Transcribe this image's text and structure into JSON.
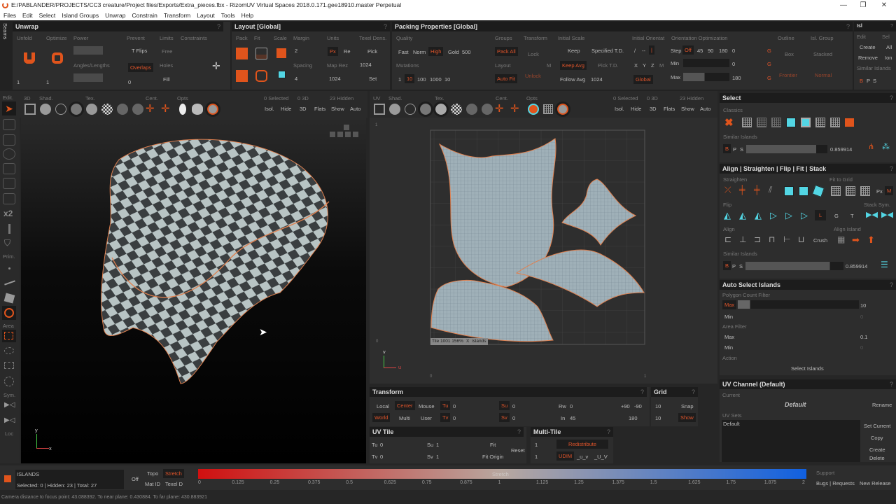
{
  "window": {
    "title": "E:/PABLANDER/PROJECTS/CC3 creature/Project files/Exports/Extra_pieces.fbx - RizomUV  Virtual Spaces 2018.0.171.gee18910.master Perpetual",
    "min": "—",
    "max": "❐",
    "close": "✕"
  },
  "menu": [
    "Files",
    "Edit",
    "Select",
    "Island Groups",
    "Unwrap",
    "Constrain",
    "Transform",
    "Layout",
    "Tools",
    "Help"
  ],
  "seams": "Seams",
  "unwrap": {
    "title": "Unwrap",
    "help": "?",
    "unfold": "Unfold",
    "optimize": "Optimize",
    "power": "Power",
    "angles": "Angles/Lengths",
    "prevent": "Prevent",
    "tflips": "T Flips",
    "overlaps": "Overlaps",
    "limits": "Limits",
    "free": "Free",
    "holes": "Holes",
    "fill": "Fill",
    "constraints": "Constraints",
    "unfold_val": "1",
    "optimize_val": "1",
    "prevent_val": "0"
  },
  "layout": {
    "title": "Layout [Global]",
    "help": "?",
    "pack": "Pack",
    "fit": "Fit",
    "scale": "Scale",
    "margin": "Margin",
    "margin_val": "2",
    "spacing": "Spacing",
    "spacing_val": "4",
    "units": "Units",
    "px": "Px",
    "re": "Re",
    "maprez": "Map Rez",
    "maprez_val": "1024",
    "texel": "Texel Dens.",
    "pick": "Pick",
    "texel_val": "1024",
    "set": "Set"
  },
  "packing": {
    "title": "Packing Properties [Global]",
    "help": "?",
    "quality": "Quality",
    "fast": "Fast",
    "norm": "Norm",
    "high": "High",
    "gold": "Gold",
    "gold_val": "500",
    "mutations": "Mutations",
    "m1": "1",
    "m10": "10",
    "m100": "100",
    "m1000": "1000",
    "mut_val": "10",
    "groups": "Groups",
    "packall": "Pack All",
    "layout": "Layout",
    "autofit": "Auto Fit",
    "transform": "Transform",
    "lock": "Lock",
    "unlock": "Unlock",
    "m": "M",
    "initscale": "Initial Scale",
    "keep": "Keep",
    "spectd": "Specified T.D.",
    "keepavg": "Keep Avg",
    "picktd": "Pick T.D.",
    "followavg": "Follow Avg",
    "follow_val": "1024",
    "initorient": "Initial Orientat",
    "o1": "/",
    "o2": "--",
    "o3": "|",
    "x": "X",
    "y": "Y",
    "z": "Z",
    "global": "Global",
    "orientopt": "Orientation Optimization",
    "step": "Step",
    "off": "Off",
    "s45": "45",
    "s90": "90",
    "s180": "180",
    "step_val": "0",
    "min": "Min",
    "min_val": "0",
    "max": "Max",
    "max_val": "180",
    "g": "G",
    "outline": "Outline",
    "box": "Box",
    "frontier": "Frontier",
    "islgroup": "Isl. Group",
    "stacked": "Stacked",
    "normal": "Normal"
  },
  "islands_panel": {
    "title": "Isl",
    "help": "?",
    "edit": "Edit",
    "sel": "Sel",
    "create": "Create",
    "all": "All",
    "remove": "Remove",
    "join": "Ion",
    "similar": "Similar Islands",
    "b": "B",
    "p": "P",
    "s": "S"
  },
  "vp3d": {
    "edit": "Edit.",
    "tabs": {
      "mode": "3D",
      "shad": "Shad.",
      "tex": "Tex.",
      "cent": "Cent.",
      "opts": "Opts"
    },
    "selected": "0 Selected",
    "count3d": "0 3D",
    "hidden": "23 Hidden",
    "isol": "Isol.",
    "hide": "Hide",
    "b3d": "3D",
    "flats": "Flats",
    "show": "Show",
    "auto": "Auto",
    "axis_y": "y",
    "axis_x": "x"
  },
  "tools": {
    "x2": "x2",
    "prim": "Prim.",
    "area": "Area",
    "sym": "Sym.",
    "loc": "Loc"
  },
  "uv": {
    "tabs": {
      "mode": "UV",
      "shad": "Shad.",
      "tex": "Tex.",
      "cent": "Cent.",
      "opts": "Opts"
    },
    "selected": "0 Selected",
    "count3d": "0 3D",
    "hidden": "23 Hidden",
    "isol": "Isol.",
    "hide": "Hide",
    "b3d": "3D",
    "flats": "Flats",
    "show": "Show",
    "auto": "Auto",
    "tile_info": "Tile 1001 156%",
    "tile_x": "X",
    "tile_islands": "islands",
    "ruler_0": "0",
    "ruler_1": "1",
    "axis_v": "v",
    "axis_u": "u"
  },
  "transform": {
    "title": "Transform",
    "help": "?",
    "local": "Local",
    "center": "Center",
    "mouse": "Mouse",
    "world": "World",
    "multi": "Multi",
    "user": "User",
    "tu": "Tu",
    "tu_val": "0",
    "tv": "Tv",
    "tv_val": "0",
    "su": "Su",
    "su_val": "0",
    "sv": "Sv",
    "sv_val": "0",
    "rw": "Rw",
    "rw_val": "0",
    "in": "In",
    "in_val": "45",
    "p90": "+90",
    "m90": "-90",
    "r180": "180"
  },
  "grid": {
    "title": "Grid",
    "help": "?",
    "v1": "10",
    "v2": "10",
    "snap": "Snap",
    "show": "Show"
  },
  "uvtile": {
    "title": "UV Tile",
    "help": "?",
    "tu": "Tu",
    "tu_val": "0",
    "tv": "Tv",
    "tv_val": "0",
    "su": "Su",
    "su_val": "1",
    "sv": "Sv",
    "sv_val": "1",
    "fit": "Fit",
    "fitorigin": "Fit Origin",
    "reset": "Reset"
  },
  "multitile": {
    "title": "Multi-Tile",
    "help": "?",
    "v1": "1",
    "v2": "1",
    "redistribute": "Redistribute",
    "udim": "UDIM",
    "uv1": "_u_v",
    "uv2": "_U_V"
  },
  "select": {
    "title": "Select",
    "help": "?",
    "classics": "Classics",
    "similar": "Similar Islands",
    "b": "B",
    "p": "P",
    "s": "S",
    "value": "0.859914"
  },
  "align": {
    "title": "Align | Straighten | Flip | Fit | Stack",
    "help": "?",
    "straighten": "Straighten",
    "fitgrid": "Fit to Grid",
    "px": "Px",
    "m": "M",
    "flip": "Flip",
    "l": "L",
    "g": "G",
    "t": "T",
    "stacksym": "Stack Sym.",
    "align": "Align",
    "crush": "Crush",
    "alignisland": "Align Island",
    "similar": "Similar Islands",
    "b": "B",
    "p": "P",
    "s": "S",
    "value": "0.859914"
  },
  "autoselect": {
    "title": "Auto Select Islands",
    "help": "?",
    "polyfilter": "Polygon Count Filter",
    "max": "Max",
    "max_val": "10",
    "min": "Min",
    "min_val": "0",
    "areafilter": "Area Filter",
    "amax": "Max",
    "amax_val": "0.1",
    "amin": "Min",
    "amin_val": "0",
    "action": "Action",
    "select": "Select Islands",
    "poly_fill": 0.1
  },
  "uvchannel": {
    "title": "UV Channel (Default)",
    "help": "?",
    "current": "Current",
    "current_val": "Default",
    "rename": "Rename",
    "uvsets": "UV Sets",
    "sets": [
      "Default"
    ],
    "setcurrent": "Set Current",
    "copy": "Copy",
    "create": "Create",
    "delete": "Delete"
  },
  "bottom": {
    "islands": "ISLANDS",
    "stats": "Selected: 0 | Hidden: 23 | Total: 27",
    "off": "Off",
    "topo": "Topo",
    "stretch": "Stretch",
    "matid": "Mat ID",
    "texeld": "Texel D",
    "bar_label": "Stretch",
    "ticks": [
      "0",
      "0.125",
      "0.25",
      "0.375",
      "0.5",
      "0.625",
      "0.75",
      "0.875",
      "1",
      "1.125",
      "1.25",
      "1.375",
      "1.5",
      "1.625",
      "1.75",
      "1.875",
      "2"
    ],
    "support": "Support",
    "bugs": "Bugs | Requests",
    "release": "New Release"
  },
  "status": "Camera distance to focus point: 43.088392. To near plane: 0.430884. To far plane: 430.883921",
  "colors": {
    "accent": "#e0541c",
    "cyan": "#53d6e4",
    "panel": "#2d2d2d"
  }
}
